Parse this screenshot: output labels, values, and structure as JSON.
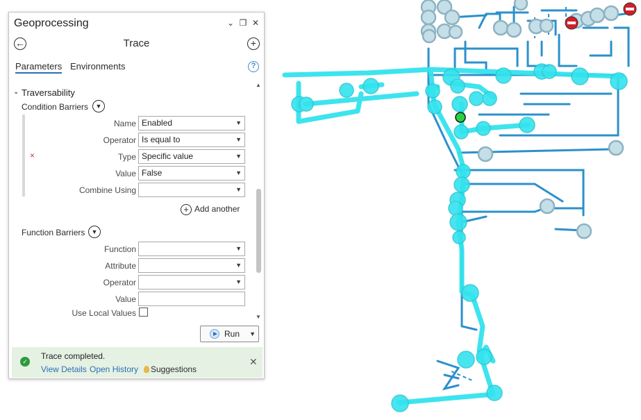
{
  "panel": {
    "title": "Geoprocessing",
    "tool_title": "Trace",
    "window_controls": {
      "collapse": "⌄",
      "maximize": "❐",
      "close": "✕"
    },
    "back_icon": "arrow-left-circle-icon",
    "add_icon": "plus-circle-icon",
    "tabs": [
      {
        "label": "Parameters",
        "active": true
      },
      {
        "label": "Environments",
        "active": false
      }
    ],
    "help_icon": "?"
  },
  "traversability": {
    "heading": "Traversability",
    "condition_barriers": {
      "label": "Condition Barriers",
      "rows": [
        {
          "label": "Name",
          "value": "Enabled"
        },
        {
          "label": "Operator",
          "value": "Is equal to"
        },
        {
          "label": "Type",
          "value": "Specific value"
        },
        {
          "label": "Value",
          "value": "False"
        },
        {
          "label": "Combine Using",
          "value": ""
        }
      ],
      "remove_icon": "×",
      "add_another": "Add another"
    },
    "function_barriers": {
      "label": "Function Barriers",
      "rows": [
        {
          "label": "Function",
          "value": ""
        },
        {
          "label": "Attribute",
          "value": ""
        },
        {
          "label": "Operator",
          "value": ""
        },
        {
          "label": "Value",
          "value": ""
        }
      ],
      "use_local_values": {
        "label": "Use Local Values",
        "checked": false
      }
    }
  },
  "run": {
    "label": "Run"
  },
  "status": {
    "message": "Trace completed.",
    "view_details": "View Details",
    "open_history": "Open History",
    "suggestions": "Suggestions",
    "close_icon": "✕"
  },
  "colors": {
    "trace_highlight": "#33e3ee",
    "network_line": "#2b90cb",
    "device_fill": "#c5dfe9",
    "device_stroke": "#8eb2c1",
    "barrier_red": "#d21f2a",
    "start_point": "#29d13f",
    "status_bg": "#e5f1e3"
  }
}
